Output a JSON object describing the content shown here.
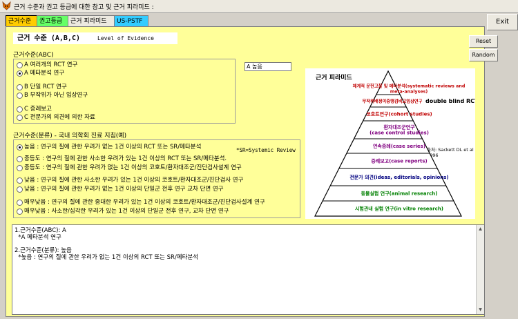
{
  "window": {
    "title": "근거 수준과 권고 등급에 대한 참고 및 근거 피라미드 :",
    "exit_label": "Exit"
  },
  "tabs": [
    {
      "label": "근거수준",
      "bg": "#ffcc00"
    },
    {
      "label": "권고등급",
      "bg": "#66ff66"
    },
    {
      "label": "근거 피라미드",
      "bg": "#ece9e0"
    },
    {
      "label": "US-PSTF",
      "bg": "#33ccff"
    }
  ],
  "main": {
    "heading": "근거 수준 (A,B,C)",
    "subheading": "Level of Evidence",
    "abc_label": "근거수준(ABC)",
    "abc_options": [
      {
        "label": "A 여러개의 RCT 연구",
        "selected": false
      },
      {
        "label": "A 메타분석 연구",
        "selected": true
      },
      {
        "label": "B 단일 RCT 연구",
        "selected": false
      },
      {
        "label": "B 무작위가 아닌 임상연구",
        "selected": false
      },
      {
        "label": "C 증례보고",
        "selected": false
      },
      {
        "label": "C 전문가의 의견에 의한 자료",
        "selected": false
      }
    ],
    "level_value": "A 높음",
    "class_label": "근거수준(분류) - 국내 의학회 진료 지침(예)",
    "sr_note": "*SR=Systemic Review",
    "class_options": [
      {
        "label": "높음 : 연구의 질에 관한 우려가 없는 1건 이상의 RCT 또는 SR/메타분석",
        "selected": true
      },
      {
        "label": "중등도 : 연구의 질에 관한 사소한 우려가 있는 1건 이상의 RCT 또는 SR/메타분석.",
        "selected": false
      },
      {
        "label": "중등도 : 연구의 질에 관한 우려가 없는 1건 이상의 코호트/환자대조군/진단검사설계 연구",
        "selected": false
      },
      {
        "label": "낮음 : 연구의 질에 관한 사소한 우려가 있는 1건 이상의 코호트/환자대조군/진단검사 연구",
        "selected": false
      },
      {
        "label": "낮음 : 연구의 질에 관한 우려가 없는 1건 이상의 단일군 전후 연구 교차 단면 연구",
        "selected": false
      },
      {
        "label": "매우낮음 : 연구의 질에 관한 중대한 우려가 있는 1건 이상의 코호트/환자대조군/진단검사설계 연구",
        "selected": false
      },
      {
        "label": "매우낮음 : 사소한/심각한 우려가 있는 1건 이상의 단일군 전후 연구, 교차 단면 연구",
        "selected": false
      }
    ],
    "reset_label": "Reset",
    "random_label": "Random"
  },
  "pyramid": {
    "title": "근거 피라미드",
    "source": "출처: Sackett DL et al 1996",
    "tiers": [
      {
        "lines": [
          "체계적 문헌고찰 및 메타분석(systematic reviews and",
          "meta-analyses)"
        ],
        "color": "#c00000"
      },
      {
        "lines": [
          "무작위배정이중맹검비교임상연구"
        ],
        "color": "#c00000",
        "extra": "double blind RCT"
      },
      {
        "lines": [
          "코호트연구(cohort studies)"
        ],
        "color": "#c00000"
      },
      {
        "lines": [
          "환자대조군연구",
          "(case control studies)"
        ],
        "color": "#800080"
      },
      {
        "lines": [
          "연속증례(case series)"
        ],
        "color": "#800080"
      },
      {
        "lines": [
          "증례보고(case reports)"
        ],
        "color": "#800080"
      },
      {
        "lines": [
          "전문가 의견(ideas, editorials, opinions)"
        ],
        "color": "#000080"
      },
      {
        "lines": [
          "동물실험 연구(animal research)"
        ],
        "color": "#008000"
      },
      {
        "lines": [
          "시험관내 실험 연구(in vitro research)"
        ],
        "color": "#008000"
      }
    ]
  },
  "result": {
    "lines": [
      "1.근거수준(ABC): A",
      "  *A 메타분석 연구",
      "",
      "2.근거수준(분류): 높음",
      "  *높음 : 연구의 질에 관한 우려가 없는 1건 이상의 RCT 또는 SR/메타분석"
    ]
  }
}
